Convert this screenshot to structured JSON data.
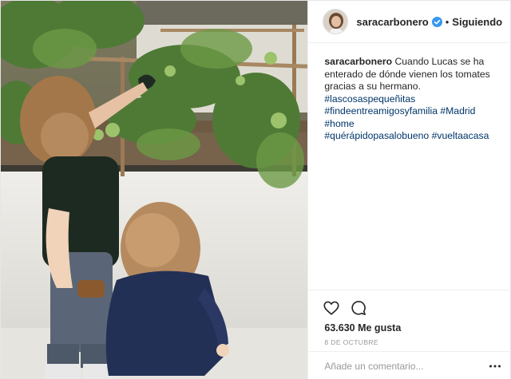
{
  "post": {
    "username": "saracarbonero",
    "verified": true,
    "follow_separator": "•",
    "follow_status": "Siguiendo",
    "caption_text": "Cuando Lucas se ha enterado de dónde vienen los tomates gracias a su hermano.",
    "hashtags": [
      "#lascosaspequeñitas",
      "#findeentreamigosyfamilia",
      "#Madrid",
      "#home",
      "#quérápidopasalobueno",
      "#vueltaacasa"
    ],
    "likes": "63.630 Me gusta",
    "date": "8 DE OCTUBRE"
  },
  "comment": {
    "placeholder": "Añade un comentario..."
  },
  "icons": {
    "like": "heart-icon",
    "comment": "comment-bubble-icon",
    "verified": "verified-badge-icon",
    "more": "more-options-icon"
  },
  "colors": {
    "verified": "#3897f0",
    "hashtag": "#003569",
    "muted": "#999999",
    "text": "#262626",
    "border": "#efefef"
  }
}
